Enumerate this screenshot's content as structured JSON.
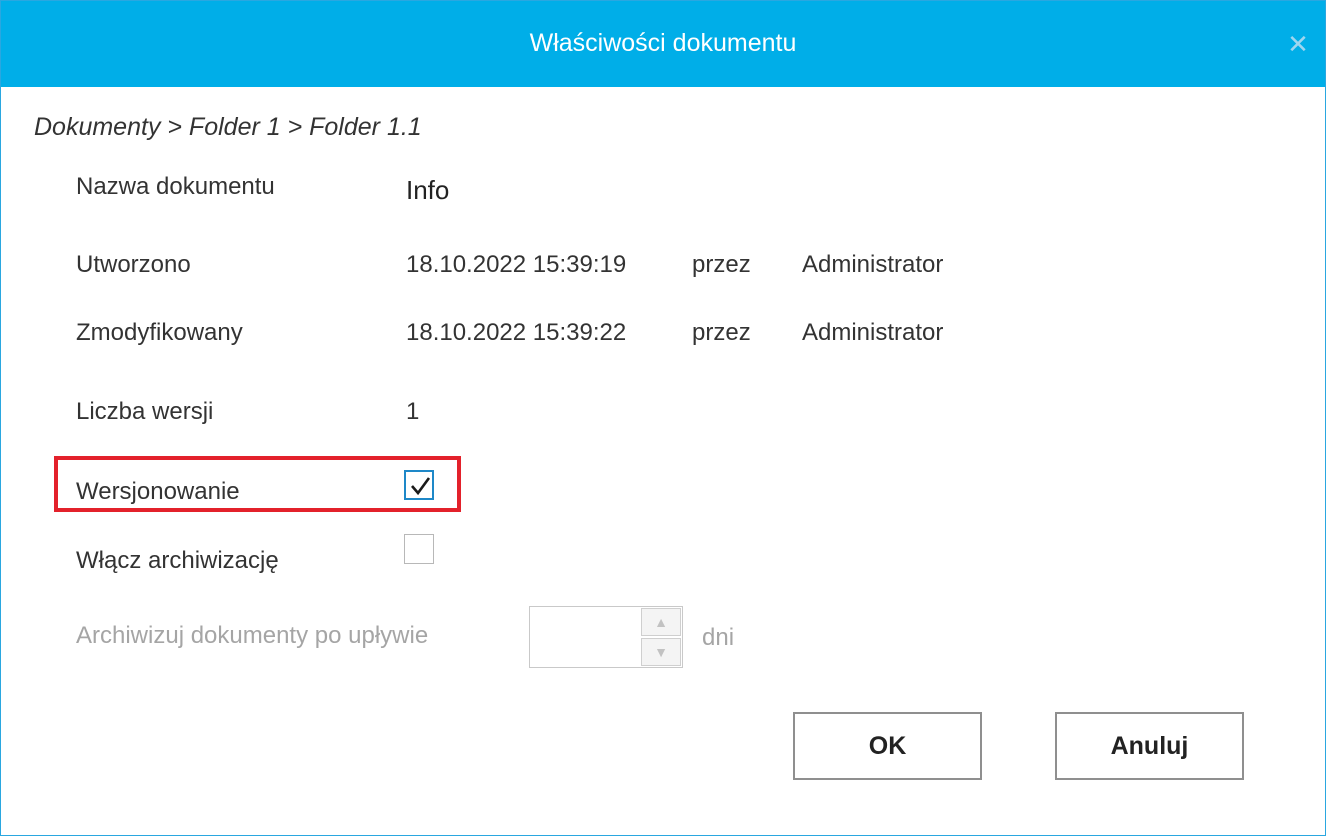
{
  "window": {
    "title": "Właściwości dokumentu",
    "close_symbol": "✕"
  },
  "breadcrumb": "Dokumenty > Folder 1 > Folder 1.1",
  "fields": {
    "name_label": "Nazwa dokumentu",
    "name_value": "Info",
    "created_label": "Utworzono",
    "created_date": "18.10.2022 15:39:19",
    "created_by_word": "przez",
    "created_by": "Administrator",
    "modified_label": "Zmodyfikowany",
    "modified_date": "18.10.2022 15:39:22",
    "modified_by_word": "przez",
    "modified_by": "Administrator",
    "versions_label": "Liczba wersji",
    "versions_value": "1",
    "versioning_label": "Wersjonowanie",
    "versioning_checked": true,
    "archive_label": "Włącz archiwizację",
    "archive_checked": false,
    "archive_after_label": "Archiwizuj dokumenty po upływie",
    "archive_after_value": "",
    "archive_after_unit": "dni"
  },
  "buttons": {
    "ok": "OK",
    "cancel": "Anuluj"
  },
  "colors": {
    "titlebar": "#00aee8",
    "highlight": "#e3212b",
    "checkbox_accent": "#1e88c8"
  },
  "icons": {
    "close": "close-icon",
    "check": "checkmark-icon",
    "spin_up": "chevron-up-icon",
    "spin_down": "chevron-down-icon"
  }
}
